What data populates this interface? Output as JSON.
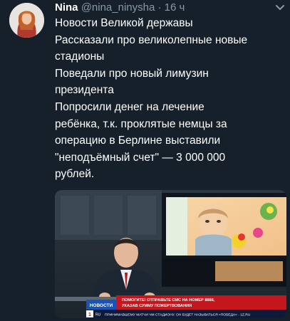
{
  "tweet": {
    "author_name": "Nina",
    "handle": "@nina_ninysha",
    "separator": "·",
    "time": "16 ч",
    "text_lines": [
      "Новости Великой державы",
      "Рассказали про великолепные новые",
      "стадионы",
      " Поведали про новый лимузин",
      "президента",
      " Попросили денег на лечение",
      "ребёнка, т.к. проклятые немцы за",
      "операцию в Берлине выставили",
      "\"неподъёмный счет\" — 3 000 000",
      "рублей."
    ]
  },
  "media": {
    "news_badge": "НОВОСТИ",
    "banner_line1": "ПОМОГИТЕ! ОТПРАВЬТЕ СМС НА НОМЕР 8888,",
    "banner_line2": "УКАЗАВ СУММУ ПОЖЕРТВОВАНИЯ",
    "channel_logo": "1",
    "ticker_text": "ПРИНИМАВШЕМУ МАТЧИ ЧМ СТАДИОНУ. ОН БУДЕТ НАЗЫВАТЬСЯ «ПОБЕДА» · 1Z.RU",
    "ticker_prefix": "RU"
  },
  "icons": {
    "menu": "chevron-down-icon",
    "avatar": "avatar-portrait"
  },
  "colors": {
    "background": "#15202b",
    "secondary_text": "#8899a6",
    "news_blue": "#1b52b8",
    "banner_red": "#c4161c"
  }
}
